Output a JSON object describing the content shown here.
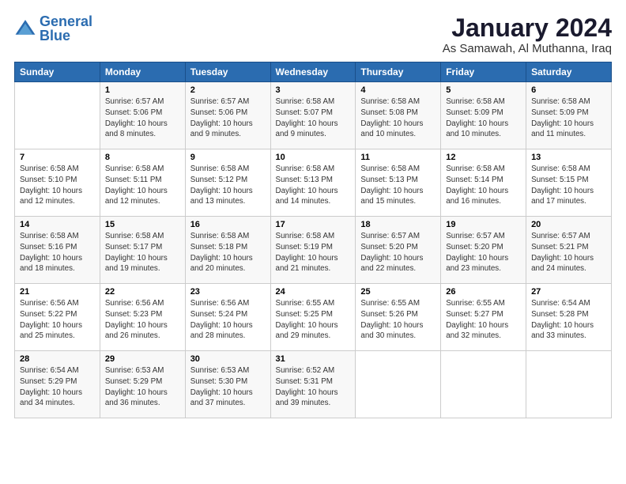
{
  "logo": {
    "line1": "General",
    "line2": "Blue"
  },
  "title": "January 2024",
  "location": "As Samawah, Al Muthanna, Iraq",
  "days_of_week": [
    "Sunday",
    "Monday",
    "Tuesday",
    "Wednesday",
    "Thursday",
    "Friday",
    "Saturday"
  ],
  "weeks": [
    [
      {
        "day": "",
        "sunrise": "",
        "sunset": "",
        "daylight": ""
      },
      {
        "day": "1",
        "sunrise": "Sunrise: 6:57 AM",
        "sunset": "Sunset: 5:06 PM",
        "daylight": "Daylight: 10 hours and 8 minutes."
      },
      {
        "day": "2",
        "sunrise": "Sunrise: 6:57 AM",
        "sunset": "Sunset: 5:06 PM",
        "daylight": "Daylight: 10 hours and 9 minutes."
      },
      {
        "day": "3",
        "sunrise": "Sunrise: 6:58 AM",
        "sunset": "Sunset: 5:07 PM",
        "daylight": "Daylight: 10 hours and 9 minutes."
      },
      {
        "day": "4",
        "sunrise": "Sunrise: 6:58 AM",
        "sunset": "Sunset: 5:08 PM",
        "daylight": "Daylight: 10 hours and 10 minutes."
      },
      {
        "day": "5",
        "sunrise": "Sunrise: 6:58 AM",
        "sunset": "Sunset: 5:09 PM",
        "daylight": "Daylight: 10 hours and 10 minutes."
      },
      {
        "day": "6",
        "sunrise": "Sunrise: 6:58 AM",
        "sunset": "Sunset: 5:09 PM",
        "daylight": "Daylight: 10 hours and 11 minutes."
      }
    ],
    [
      {
        "day": "7",
        "sunrise": "Sunrise: 6:58 AM",
        "sunset": "Sunset: 5:10 PM",
        "daylight": "Daylight: 10 hours and 12 minutes."
      },
      {
        "day": "8",
        "sunrise": "Sunrise: 6:58 AM",
        "sunset": "Sunset: 5:11 PM",
        "daylight": "Daylight: 10 hours and 12 minutes."
      },
      {
        "day": "9",
        "sunrise": "Sunrise: 6:58 AM",
        "sunset": "Sunset: 5:12 PM",
        "daylight": "Daylight: 10 hours and 13 minutes."
      },
      {
        "day": "10",
        "sunrise": "Sunrise: 6:58 AM",
        "sunset": "Sunset: 5:13 PM",
        "daylight": "Daylight: 10 hours and 14 minutes."
      },
      {
        "day": "11",
        "sunrise": "Sunrise: 6:58 AM",
        "sunset": "Sunset: 5:13 PM",
        "daylight": "Daylight: 10 hours and 15 minutes."
      },
      {
        "day": "12",
        "sunrise": "Sunrise: 6:58 AM",
        "sunset": "Sunset: 5:14 PM",
        "daylight": "Daylight: 10 hours and 16 minutes."
      },
      {
        "day": "13",
        "sunrise": "Sunrise: 6:58 AM",
        "sunset": "Sunset: 5:15 PM",
        "daylight": "Daylight: 10 hours and 17 minutes."
      }
    ],
    [
      {
        "day": "14",
        "sunrise": "Sunrise: 6:58 AM",
        "sunset": "Sunset: 5:16 PM",
        "daylight": "Daylight: 10 hours and 18 minutes."
      },
      {
        "day": "15",
        "sunrise": "Sunrise: 6:58 AM",
        "sunset": "Sunset: 5:17 PM",
        "daylight": "Daylight: 10 hours and 19 minutes."
      },
      {
        "day": "16",
        "sunrise": "Sunrise: 6:58 AM",
        "sunset": "Sunset: 5:18 PM",
        "daylight": "Daylight: 10 hours and 20 minutes."
      },
      {
        "day": "17",
        "sunrise": "Sunrise: 6:58 AM",
        "sunset": "Sunset: 5:19 PM",
        "daylight": "Daylight: 10 hours and 21 minutes."
      },
      {
        "day": "18",
        "sunrise": "Sunrise: 6:57 AM",
        "sunset": "Sunset: 5:20 PM",
        "daylight": "Daylight: 10 hours and 22 minutes."
      },
      {
        "day": "19",
        "sunrise": "Sunrise: 6:57 AM",
        "sunset": "Sunset: 5:20 PM",
        "daylight": "Daylight: 10 hours and 23 minutes."
      },
      {
        "day": "20",
        "sunrise": "Sunrise: 6:57 AM",
        "sunset": "Sunset: 5:21 PM",
        "daylight": "Daylight: 10 hours and 24 minutes."
      }
    ],
    [
      {
        "day": "21",
        "sunrise": "Sunrise: 6:56 AM",
        "sunset": "Sunset: 5:22 PM",
        "daylight": "Daylight: 10 hours and 25 minutes."
      },
      {
        "day": "22",
        "sunrise": "Sunrise: 6:56 AM",
        "sunset": "Sunset: 5:23 PM",
        "daylight": "Daylight: 10 hours and 26 minutes."
      },
      {
        "day": "23",
        "sunrise": "Sunrise: 6:56 AM",
        "sunset": "Sunset: 5:24 PM",
        "daylight": "Daylight: 10 hours and 28 minutes."
      },
      {
        "day": "24",
        "sunrise": "Sunrise: 6:55 AM",
        "sunset": "Sunset: 5:25 PM",
        "daylight": "Daylight: 10 hours and 29 minutes."
      },
      {
        "day": "25",
        "sunrise": "Sunrise: 6:55 AM",
        "sunset": "Sunset: 5:26 PM",
        "daylight": "Daylight: 10 hours and 30 minutes."
      },
      {
        "day": "26",
        "sunrise": "Sunrise: 6:55 AM",
        "sunset": "Sunset: 5:27 PM",
        "daylight": "Daylight: 10 hours and 32 minutes."
      },
      {
        "day": "27",
        "sunrise": "Sunrise: 6:54 AM",
        "sunset": "Sunset: 5:28 PM",
        "daylight": "Daylight: 10 hours and 33 minutes."
      }
    ],
    [
      {
        "day": "28",
        "sunrise": "Sunrise: 6:54 AM",
        "sunset": "Sunset: 5:29 PM",
        "daylight": "Daylight: 10 hours and 34 minutes."
      },
      {
        "day": "29",
        "sunrise": "Sunrise: 6:53 AM",
        "sunset": "Sunset: 5:29 PM",
        "daylight": "Daylight: 10 hours and 36 minutes."
      },
      {
        "day": "30",
        "sunrise": "Sunrise: 6:53 AM",
        "sunset": "Sunset: 5:30 PM",
        "daylight": "Daylight: 10 hours and 37 minutes."
      },
      {
        "day": "31",
        "sunrise": "Sunrise: 6:52 AM",
        "sunset": "Sunset: 5:31 PM",
        "daylight": "Daylight: 10 hours and 39 minutes."
      },
      {
        "day": "",
        "sunrise": "",
        "sunset": "",
        "daylight": ""
      },
      {
        "day": "",
        "sunrise": "",
        "sunset": "",
        "daylight": ""
      },
      {
        "day": "",
        "sunrise": "",
        "sunset": "",
        "daylight": ""
      }
    ]
  ]
}
